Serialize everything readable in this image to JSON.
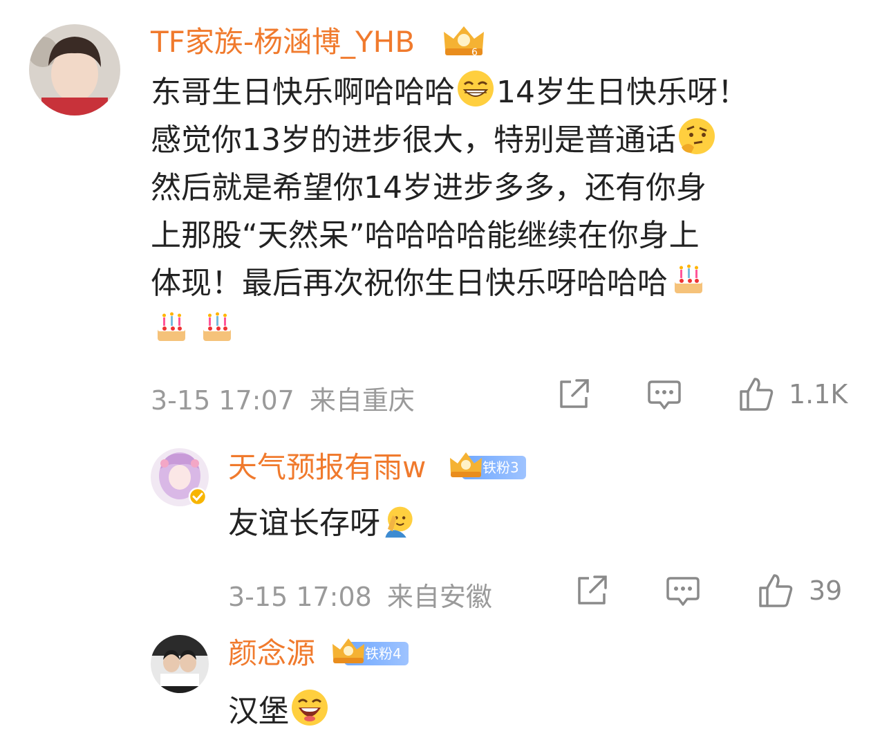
{
  "comments": [
    {
      "user": "TF家族-杨涵博_YHB",
      "text_lines": [
        "东哥生日快乐啊哈哈哈",
        "14岁生日快乐呀！",
        "感觉你13岁的进步很大，特别是普通话",
        "然后就是希望你14岁进步多多，还有你身",
        "上那股“天然呆”哈哈哈哈能继续在你身上",
        "体现！最后再次祝你生日快乐呀哈哈哈"
      ],
      "emojis": [
        "grin-emoji",
        "thinking-emoji",
        "cake-emoji",
        "cake-emoji",
        "cake-emoji"
      ],
      "time": "3-15 17:07",
      "location": "来自重庆",
      "likes": "1.1K"
    },
    {
      "user": "天气预报有雨w",
      "badge": "铁粉3",
      "text": "友谊长存呀",
      "emoji": "salute-emoji",
      "time": "3-15 17:08",
      "location": "来自安徽",
      "likes": "39"
    },
    {
      "user": "颜念源",
      "badge": "铁粉4",
      "text": "汉堡",
      "emoji": "laugh-emoji"
    }
  ],
  "colors": {
    "username": "#f07a2d",
    "meta": "#9a9a9a",
    "badge": "#6fa8ff",
    "text": "#222222"
  },
  "icons": [
    "share-icon",
    "comment-icon",
    "like-icon",
    "crown-badge-icon",
    "verified-icon"
  ]
}
